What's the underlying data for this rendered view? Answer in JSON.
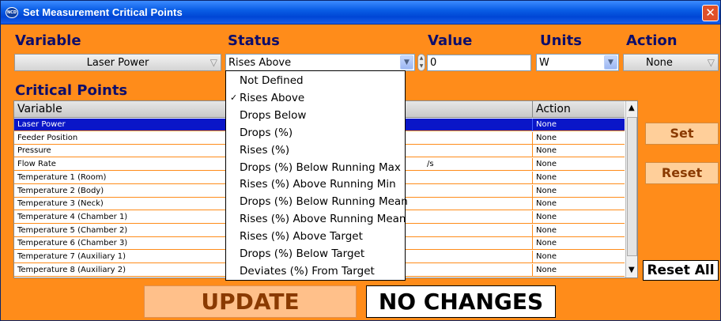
{
  "window": {
    "title": "Set Measurement Critical Points",
    "close_glyph": "✕",
    "icon_label": "NCD"
  },
  "columns": {
    "variable": "Variable",
    "status": "Status",
    "value": "Value",
    "units": "Units",
    "action": "Action"
  },
  "controls": {
    "variable_selected": "Laser Power",
    "status_selected": "Rises Above",
    "value": "0",
    "units_selected": "W",
    "action_selected": "None"
  },
  "critical_points": {
    "title": "Critical Points",
    "headers": {
      "variable": "Variable",
      "action": "Action"
    },
    "rows": [
      {
        "variable": "Laser Power",
        "value": "",
        "action": "None",
        "selected": true
      },
      {
        "variable": "Feeder Position",
        "value": "",
        "action": "None"
      },
      {
        "variable": "Pressure",
        "value": "",
        "action": "None"
      },
      {
        "variable": "Flow Rate",
        "value": "/s",
        "action": "None"
      },
      {
        "variable": "Temperature 1 (Room)",
        "value": "",
        "action": "None"
      },
      {
        "variable": "Temperature 2 (Body)",
        "value": "",
        "action": "None"
      },
      {
        "variable": "Temperature 3 (Neck)",
        "value": "",
        "action": "None"
      },
      {
        "variable": "Temperature 4 (Chamber 1)",
        "value": "",
        "action": "None"
      },
      {
        "variable": "Temperature 5 (Chamber 2)",
        "value": "",
        "action": "None"
      },
      {
        "variable": "Temperature 6 (Chamber 3)",
        "value": "",
        "action": "None"
      },
      {
        "variable": "Temperature 7 (Auxiliary 1)",
        "value": "",
        "action": "None"
      },
      {
        "variable": "Temperature 8 (Auxiliary 2)",
        "value": "",
        "action": "None"
      }
    ]
  },
  "buttons": {
    "set": "Set",
    "reset": "Reset",
    "reset_all": "Reset All",
    "update": "UPDATE",
    "no_changes": "NO CHANGES"
  },
  "status_dropdown": {
    "checkmark": "✓",
    "options": [
      {
        "label": "Not Defined",
        "checked": false
      },
      {
        "label": "Rises Above",
        "checked": true
      },
      {
        "label": "Drops Below",
        "checked": false
      },
      {
        "label": "Drops (%)",
        "checked": false
      },
      {
        "label": "Rises (%)",
        "checked": false
      },
      {
        "label": "Drops (%) Below Running Max",
        "checked": false
      },
      {
        "label": "Rises (%) Above Running Min",
        "checked": false
      },
      {
        "label": "Drops (%) Below Running Mean",
        "checked": false
      },
      {
        "label": "Rises (%) Above Running Mean",
        "checked": false
      },
      {
        "label": "Rises (%) Above Target",
        "checked": false
      },
      {
        "label": "Drops (%) Below Target",
        "checked": false
      },
      {
        "label": "Deviates (%) From Target",
        "checked": false
      }
    ]
  },
  "colors": {
    "background": "#ff8c1a",
    "header_text": "#0d0d6b",
    "selection": "#0a16c8"
  }
}
